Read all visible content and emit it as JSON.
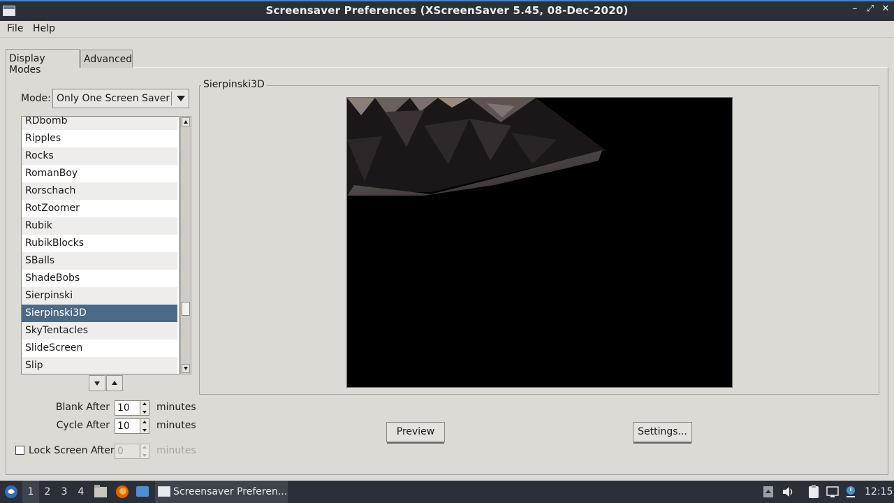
{
  "window": {
    "title": "Screensaver Preferences  (XScreenSaver 5.45, 08-Dec-2020)",
    "minimize": "–",
    "maximize": "⤢",
    "close": "✕"
  },
  "menu": {
    "file": "File",
    "help": "Help"
  },
  "tabs": {
    "display_modes": "Display Modes",
    "advanced": "Advanced"
  },
  "mode": {
    "label": "Mode:",
    "value": "Only One Screen Saver"
  },
  "hacks": [
    {
      "name": "RDbomb"
    },
    {
      "name": "Ripples"
    },
    {
      "name": "Rocks"
    },
    {
      "name": "RomanBoy"
    },
    {
      "name": "Rorschach"
    },
    {
      "name": "RotZoomer"
    },
    {
      "name": "Rubik"
    },
    {
      "name": "RubikBlocks"
    },
    {
      "name": "SBalls"
    },
    {
      "name": "ShadeBobs"
    },
    {
      "name": "Sierpinski"
    },
    {
      "name": "Sierpinski3D",
      "selected": true
    },
    {
      "name": "SkyTentacles"
    },
    {
      "name": "SlideScreen"
    },
    {
      "name": "Slip"
    }
  ],
  "timing": {
    "blank_after_label": "Blank After",
    "blank_after_value": "10",
    "cycle_after_label": "Cycle After",
    "cycle_after_value": "10",
    "lock_label": "Lock Screen After",
    "lock_value": "0",
    "lock_checked": false,
    "unit": "minutes"
  },
  "preview": {
    "legend": "Sierpinski3D",
    "preview_button": "Preview",
    "settings_button": "Settings..."
  },
  "taskbar": {
    "workspaces": [
      "1",
      "2",
      "3",
      "4"
    ],
    "active_workspace": "1",
    "task_label": "Screensaver Preferen...",
    "clock": "12:15"
  },
  "colors": {
    "selection": "#4b6a88",
    "titlebar": "#2b3038",
    "background": "#dcdad5"
  }
}
